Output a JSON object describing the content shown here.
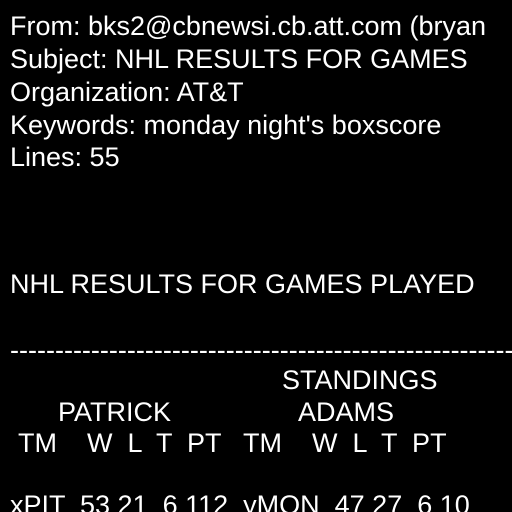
{
  "header": {
    "from": "From: bks2@cbnewsi.cb.att.com (bryan",
    "subject": "Subject: NHL RESULTS FOR GAMES",
    "organization": "Organization: AT&T",
    "keywords": "Keywords: monday night's boxscore",
    "lines": "Lines: 55"
  },
  "body": {
    "title": "NHL RESULTS FOR GAMES PLAYED",
    "divider": "--------------------------------------------------------",
    "standings_label": "STANDINGS",
    "division_left": "PATRICK",
    "division_right": "ADAMS",
    "columns": "TM    W  L  T  PT   TM    W  L  T  PT",
    "first_row": "xPIT  53 21  6 112  yMON  47 27  6 10"
  }
}
